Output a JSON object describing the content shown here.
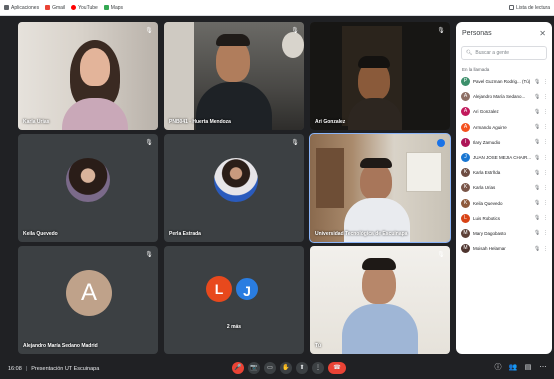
{
  "bookmarks": {
    "items": [
      {
        "label": "Aplicaciones",
        "color": "#5f6368"
      },
      {
        "label": "Gmail",
        "color": "#ea4335"
      },
      {
        "label": "YouTube",
        "color": "#ff0000"
      },
      {
        "label": "Maps",
        "color": "#34a853"
      }
    ],
    "right_label": "Lista de lectura"
  },
  "tiles": [
    {
      "name": "Karla Urias",
      "mic": "🎙"
    },
    {
      "name": "PNB041 - Huerta Mendoza",
      "mic": "🎙"
    },
    {
      "name": "Ari Gonzalez",
      "mic": "🎙"
    },
    {
      "name": "Keila Quevedo",
      "mic": "🎙"
    },
    {
      "name": "Perla Estrada",
      "mic": "🎙"
    },
    {
      "name": "Universidad Tecnológica de Escuinapa",
      "mic": ""
    },
    {
      "name": "Alejandro María Sedano Madrid",
      "mic": "🎙",
      "initial": "A"
    },
    {
      "name": "2 más",
      "initial_1": "L",
      "initial_2": "J"
    },
    {
      "name": "Tú",
      "mic": "🎙"
    }
  ],
  "people": {
    "title": "Personas",
    "close": "✕",
    "search_placeholder": "Buscar a gente",
    "section_label": "En la llamada",
    "list": [
      {
        "name": "Pavel Guzman Rodrig... (Tú)",
        "initial": "P",
        "color": "#3c8f6b"
      },
      {
        "name": "Alejandro María Sedano...",
        "initial": "A",
        "color": "#8d6e63"
      },
      {
        "name": "Ari Gonzalez",
        "initial": "A",
        "color": "#c2185b"
      },
      {
        "name": "Armando Aguirre",
        "initial": "A",
        "color": "#f4511e"
      },
      {
        "name": "Ilary Zamudio",
        "initial": "I",
        "color": "#ad1457"
      },
      {
        "name": "JUAN JOSE MEJIA CHAIR...",
        "initial": "J",
        "color": "#1976d2"
      },
      {
        "name": "Karla Estrñda",
        "initial": "K",
        "color": "#6d4c41"
      },
      {
        "name": "Karla Urias",
        "initial": "K",
        "color": "#795548"
      },
      {
        "name": "Keila Quevedo",
        "initial": "K",
        "color": "#8e5a3c"
      },
      {
        "name": "Luis Robotics",
        "initial": "L",
        "color": "#d84315"
      },
      {
        "name": "Mary Dagobasto",
        "initial": "M",
        "color": "#5d4037"
      },
      {
        "name": "Moisah Helamar",
        "initial": "M",
        "color": "#4e342e"
      }
    ]
  },
  "bottom": {
    "time": "16:08",
    "separator": "|",
    "meeting_title": "Presentación UT Escuinapa"
  },
  "controls": [
    "🎤",
    "📷",
    "▭",
    "✋",
    "⬆",
    "⋮"
  ],
  "right_controls": [
    "ⓘ",
    "👥",
    "▤",
    "⋯"
  ]
}
